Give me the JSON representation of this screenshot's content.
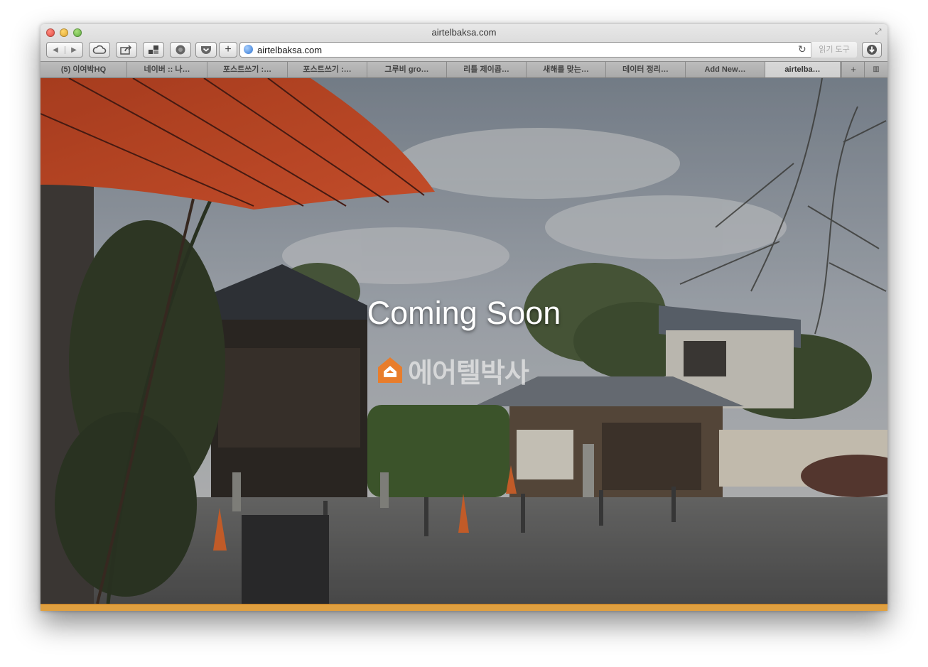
{
  "window": {
    "title": "airtelbaksa.com"
  },
  "toolbar": {
    "back_icon": "back-arrow-icon",
    "forward_icon": "forward-arrow-icon",
    "icloud_icon": "cloud-icon",
    "share_icon": "share-icon",
    "top_sites_icon": "top-sites-icon",
    "extension_icon": "extension-icon",
    "pocket_icon": "pocket-icon",
    "add_icon": "plus-icon",
    "reload_icon": "reload-icon",
    "reader_label": "읽기 도구",
    "downloads_icon": "download-icon"
  },
  "address": {
    "url": "airtelbaksa.com"
  },
  "tabs": [
    {
      "label": "(5) 이여박HQ",
      "active": false
    },
    {
      "label": "네이버 :: 나…",
      "active": false
    },
    {
      "label": "포스트쓰기 :…",
      "active": false
    },
    {
      "label": "포스트쓰기 :…",
      "active": false
    },
    {
      "label": "그루비 gro…",
      "active": false
    },
    {
      "label": "리틀 제이콥…",
      "active": false
    },
    {
      "label": "새해를 맞는…",
      "active": false
    },
    {
      "label": "데이터 정리…",
      "active": false
    },
    {
      "label": "Add New…",
      "active": false
    },
    {
      "label": "airtelba…",
      "active": true
    }
  ],
  "page": {
    "headline": "Coming Soon",
    "brand_name": "에어텔박사",
    "accent_color": "#e0a040",
    "brand_color": "#e87d2c"
  }
}
